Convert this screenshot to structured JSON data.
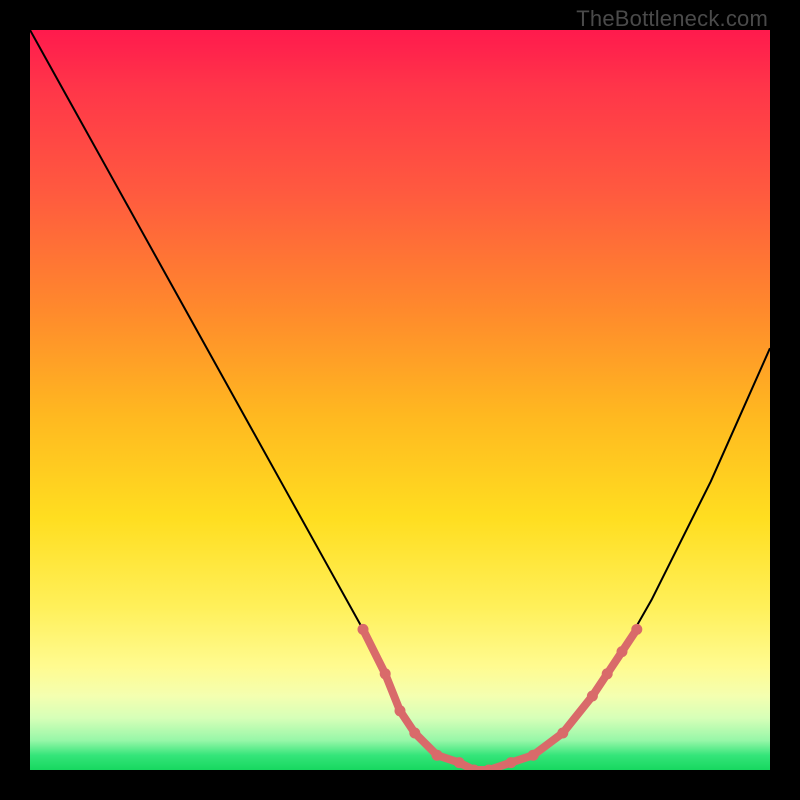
{
  "watermark": "TheBottleneck.com",
  "colors": {
    "background": "#000000",
    "gradient_top": "#ff1a4d",
    "gradient_bottom": "#17d85f",
    "curve": "#000000",
    "markers": "#d96a6a"
  },
  "chart_data": {
    "type": "line",
    "title": "",
    "xlabel": "",
    "ylabel": "",
    "xlim": [
      0,
      100
    ],
    "ylim": [
      0,
      100
    ],
    "grid": false,
    "legend": false,
    "series": [
      {
        "name": "bottleneck-curve",
        "x": [
          0,
          5,
          10,
          15,
          20,
          25,
          30,
          35,
          40,
          45,
          48,
          50,
          52,
          55,
          58,
          60,
          62,
          65,
          68,
          72,
          76,
          80,
          84,
          88,
          92,
          96,
          100
        ],
        "y": [
          100,
          91,
          82,
          73,
          64,
          55,
          46,
          37,
          28,
          19,
          13,
          8,
          5,
          2,
          1,
          0,
          0,
          1,
          2,
          5,
          10,
          16,
          23,
          31,
          39,
          48,
          57
        ]
      }
    ],
    "markers": {
      "name": "highlighted-points",
      "x": [
        45,
        48,
        50,
        52,
        55,
        58,
        60,
        62,
        65,
        68,
        72,
        76,
        78,
        80,
        82
      ],
      "y": [
        19,
        13,
        8,
        5,
        2,
        1,
        0,
        0,
        1,
        2,
        5,
        10,
        13,
        16,
        19
      ]
    }
  }
}
